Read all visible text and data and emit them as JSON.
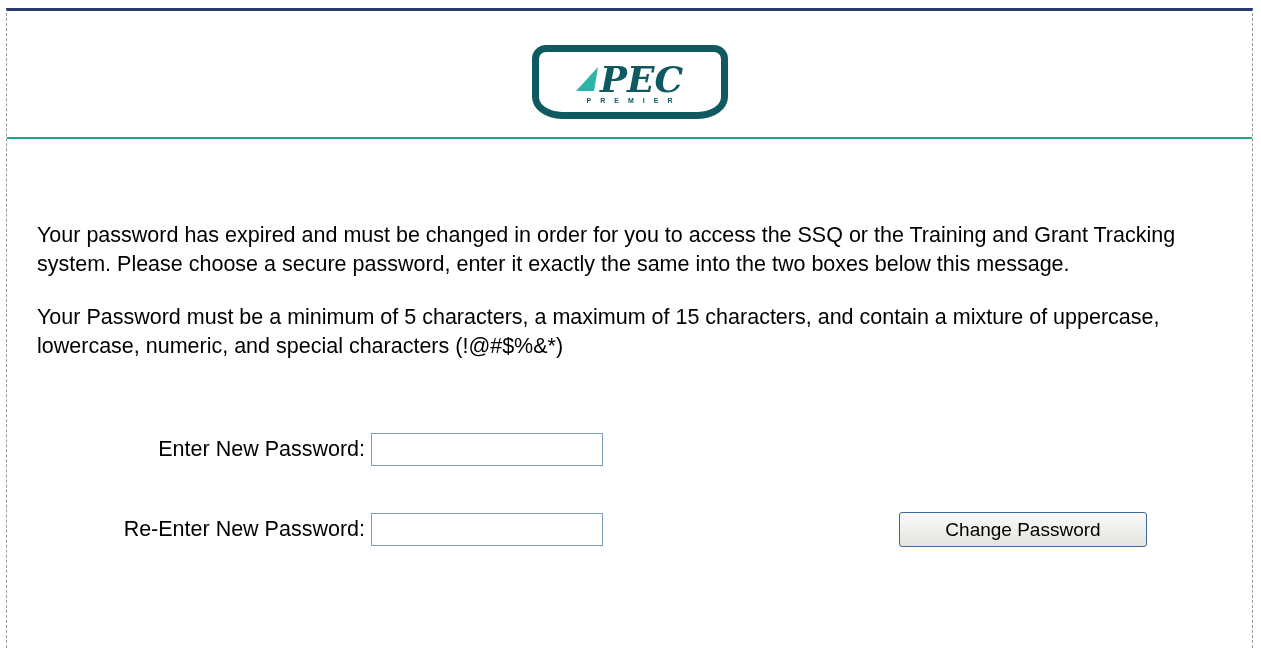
{
  "logo": {
    "name": "PEC",
    "tagline": "PREMIER"
  },
  "messages": [
    "Your password has expired and must be changed in order for you to access the SSQ or the Training and Grant Tracking system. Please choose a secure password, enter it exactly the same into the two boxes below this message.",
    "Your Password must be a minimum of 5 characters, a maximum of 15 characters, and contain a mixture of uppercase, lowercase, numeric, and special characters (!@#$%&*)"
  ],
  "fields": [
    {
      "label": "Enter New Password:"
    },
    {
      "label": "Re-Enter New Password:"
    }
  ],
  "button": "Change Password"
}
